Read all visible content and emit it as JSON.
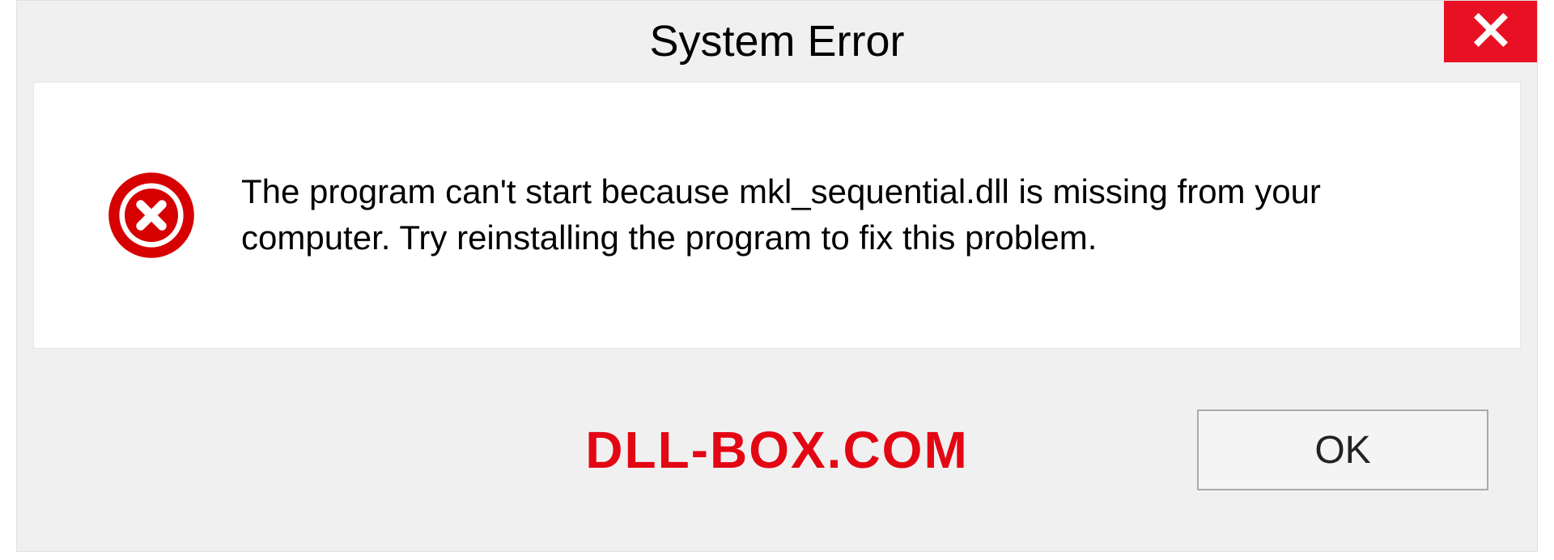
{
  "dialog": {
    "title": "System Error",
    "message": "The program can't start because mkl_sequential.dll is missing from your computer. Try reinstalling the program to fix this problem.",
    "ok_label": "OK"
  },
  "watermark": "DLL-BOX.COM",
  "colors": {
    "close_red": "#e81123",
    "icon_red": "#d60000",
    "watermark_red": "#e30613"
  }
}
